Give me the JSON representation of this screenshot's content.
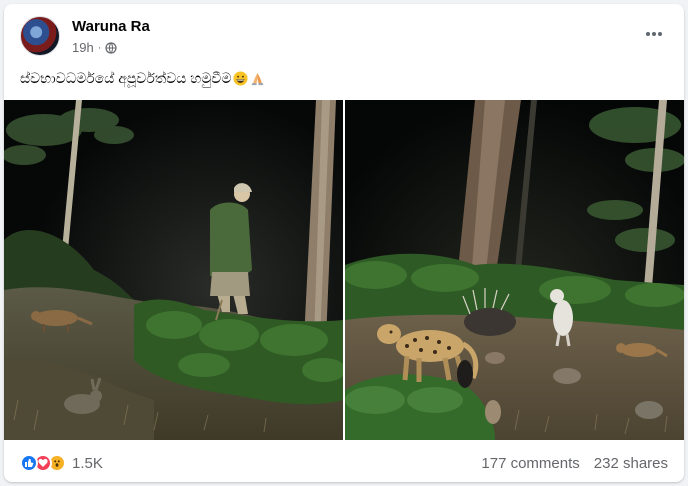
{
  "post": {
    "author": "Waruna Ra",
    "time": "19h",
    "separator": "·",
    "caption": "ස්වභාවධර්මයේ අපූර්වත්වය හමුවීම"
  },
  "icons": {
    "audience": "globe-icon",
    "more": "more-horizontal-icon",
    "caption_emojis": [
      "grinning-face-icon",
      "folded-hands-icon"
    ],
    "reactions": [
      "like-icon",
      "love-icon",
      "wow-icon"
    ]
  },
  "photos": [
    {
      "id": "photo-left",
      "subject": "night-forest-man-and-animals"
    },
    {
      "id": "photo-right",
      "subject": "night-forest-leopard-and-animals"
    }
  ],
  "footer": {
    "reaction_count": "1.5K",
    "comments": "177 comments",
    "shares": "232 shares"
  },
  "colors": {
    "brand_blue": "#1877f2",
    "love_red": "#f33e58",
    "wow_yellow": "#f7b125",
    "secondary_text": "#65676b"
  }
}
